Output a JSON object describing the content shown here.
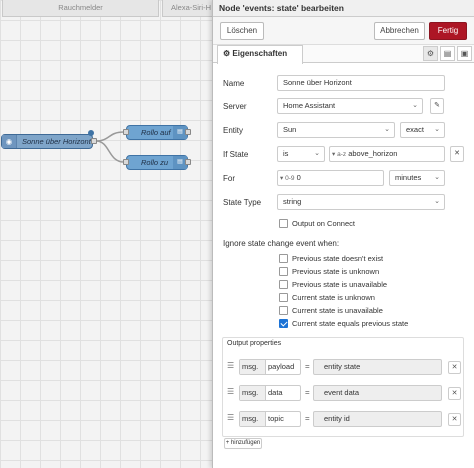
{
  "canvas": {
    "tabs": [
      "Rauchmelder",
      "Alexa-Siri-H"
    ],
    "source_node": {
      "label": "Sonne über Horizont"
    },
    "nodes": [
      {
        "label": "Rollo auf"
      },
      {
        "label": "Rollo zu"
      }
    ]
  },
  "editor": {
    "title": "Node 'events: state' bearbeiten",
    "toolbar": {
      "delete": "Löschen",
      "cancel": "Abbrechen",
      "done": "Fertig"
    },
    "tab_properties": "Eigenschaften",
    "fields": {
      "name": {
        "label": "Name",
        "value": "Sonne über Horizont"
      },
      "server": {
        "label": "Server",
        "value": "Home Assistant"
      },
      "entity": {
        "label": "Entity",
        "value": "Sun",
        "match": "exact"
      },
      "if_state": {
        "label": "If State",
        "operator": "is",
        "type_icon": "a-z",
        "value": "above_horizon"
      },
      "for": {
        "label": "For",
        "type_icon": "0-9",
        "value": "0",
        "unit": "minutes"
      },
      "state_type": {
        "label": "State Type",
        "value": "string"
      }
    },
    "output_on_connect": {
      "label": "Output on Connect",
      "checked": false
    },
    "ignore_title": "Ignore state change event when:",
    "ignore_options": [
      {
        "label": "Previous state doesn't exist",
        "checked": false
      },
      {
        "label": "Previous state is unknown",
        "checked": false
      },
      {
        "label": "Previous state is unavailable",
        "checked": false
      },
      {
        "label": "Current state is unknown",
        "checked": false
      },
      {
        "label": "Current state is unavailable",
        "checked": false
      },
      {
        "label": "Current state equals previous state",
        "checked": true
      }
    ],
    "output_properties": {
      "title": "Output properties",
      "rows": [
        {
          "prefix": "msg.",
          "property": "payload",
          "value": "entity state"
        },
        {
          "prefix": "msg.",
          "property": "data",
          "value": "event data"
        },
        {
          "prefix": "msg.",
          "property": "topic",
          "value": "entity id"
        }
      ],
      "add_label": "+ hinzufügen"
    },
    "accent_color": "#ad1625",
    "checkbox_color": "#1c73d6"
  }
}
